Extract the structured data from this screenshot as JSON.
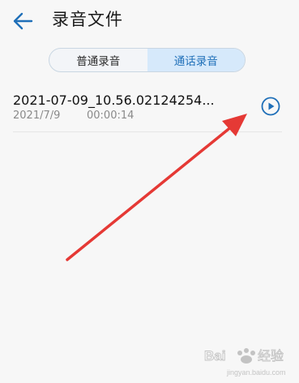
{
  "header": {
    "title": "录音文件",
    "back_icon": "arrow-left-icon"
  },
  "tabs": [
    {
      "label": "普通录音",
      "active": false
    },
    {
      "label": "通话录音",
      "active": true
    }
  ],
  "recordings": [
    {
      "name": "2021-07-09_10.56.02124254...",
      "date": "2021/7/9",
      "duration": "00:00:14",
      "action_icon": "play-icon"
    }
  ],
  "colors": {
    "accent": "#1f6fb8",
    "annotation": "#e53935"
  },
  "watermark": {
    "text": "Baidu经验",
    "url": "jingyan.baidu.com"
  }
}
